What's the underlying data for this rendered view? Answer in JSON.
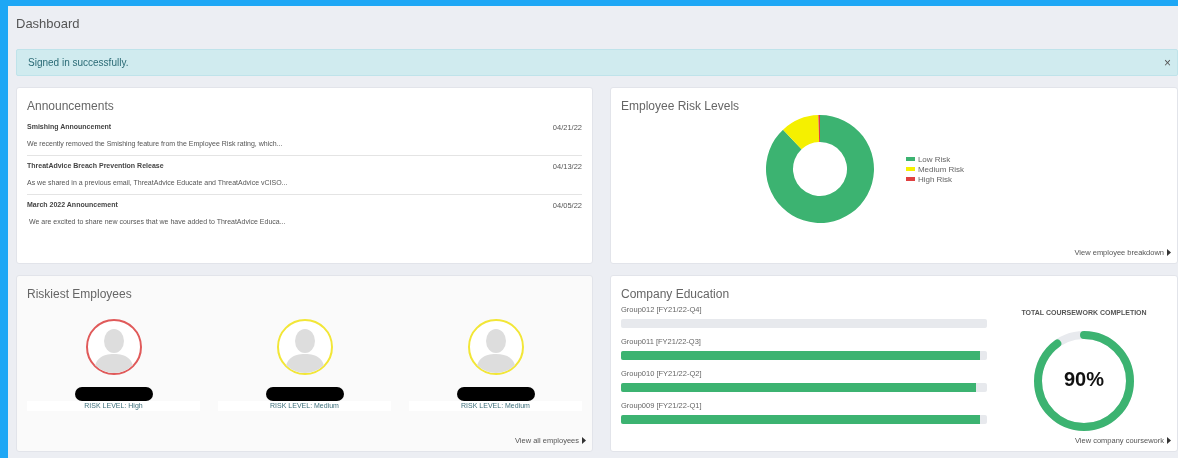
{
  "page": {
    "title": "Dashboard"
  },
  "alert": {
    "message": "Signed in successfully.",
    "close": "×"
  },
  "announcements": {
    "title": "Announcements",
    "items": [
      {
        "title": "Smishing Announcement",
        "date": "04/21/22",
        "excerpt": "We recently removed the Smishing feature from the Employee Risk rating, which..."
      },
      {
        "title": "ThreatAdvice Breach Prevention Release",
        "date": "04/13/22",
        "excerpt": "As we shared in a previous email, ThreatAdvice Educate and ThreatAdvice vCISO..."
      },
      {
        "title": "March 2022 Announcement",
        "date": "04/05/22",
        "excerpt": " We are excited to share new courses that we have added to ThreatAdvice Educa..."
      }
    ]
  },
  "risk_levels": {
    "title": "Employee Risk Levels",
    "legend": [
      {
        "label": "Low Risk",
        "color": "#3cb371"
      },
      {
        "label": "Medium Risk",
        "color": "#f5f000"
      },
      {
        "label": "High Risk",
        "color": "#e04040"
      }
    ],
    "link": "View employee breakdown"
  },
  "riskiest": {
    "title": "Riskiest Employees",
    "employees": [
      {
        "risk": "RISK LEVEL: High",
        "color": "#e05a5a"
      },
      {
        "risk": "RISK LEVEL: Medium",
        "color": "#f2e637"
      },
      {
        "risk": "RISK LEVEL: Medium",
        "color": "#f2e637"
      }
    ],
    "link": "View all employees"
  },
  "education": {
    "title": "Company Education",
    "groups": [
      {
        "label": "Group012 [FY21/22-Q4]",
        "level": 0
      },
      {
        "label": "Group011 [FY21/22-Q3]",
        "level": 0.98
      },
      {
        "label": "Group010 [FY21/22-Q2]",
        "level": 0.97
      },
      {
        "label": "Group009 [FY21/22-Q1]",
        "level": 0.98
      }
    ],
    "total_title": "TOTAL COURSEWORK COMPLETION",
    "total": {
      "reading": "90%",
      "level": 0.9
    },
    "link": "View company coursework"
  }
}
